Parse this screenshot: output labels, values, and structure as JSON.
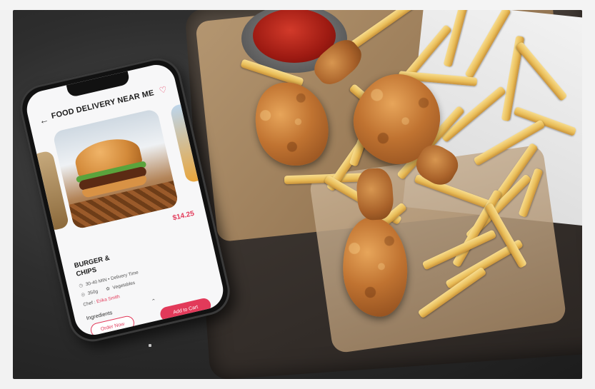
{
  "app": {
    "header_title": "FOOD DELIVERY NEAR ME",
    "back_icon": "arrow-left-icon",
    "favorite_icon": "heart-icon"
  },
  "product": {
    "price": "$14.25",
    "name": "BURGER & CHIPS",
    "delivery": "30-40 MIN • Delivery Time",
    "weight": "350g",
    "diet": "Vegetables",
    "chef_label": "Chef :",
    "chef_name": "Erika Smith"
  },
  "ingredients_label": "Ingredients",
  "buttons": {
    "order_now": "Order Now",
    "add_to_cart": "Add to Cart"
  },
  "colors": {
    "accent": "#e23a5a",
    "background": "#2e2e2e"
  }
}
